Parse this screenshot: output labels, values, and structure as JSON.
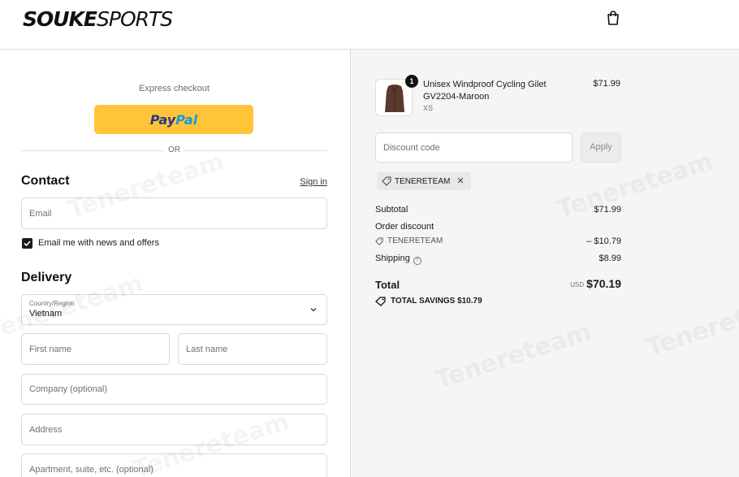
{
  "header": {
    "logo_bold": "SOUKE",
    "logo_rest": "SPORTS",
    "cart_icon": "shopping-bag-icon"
  },
  "checkout": {
    "express_label": "Express checkout",
    "paypal_pay": "Pay",
    "paypal_pal": "Pal",
    "or_label": "OR"
  },
  "contact": {
    "title": "Contact",
    "sign_in": "Sign in",
    "email_placeholder": "Email",
    "newsletter_label": "Email me with news and offers",
    "newsletter_checked": true
  },
  "delivery": {
    "title": "Delivery",
    "country_label": "Country/Region",
    "country_value": "Vietnam",
    "first_name_placeholder": "First name",
    "last_name_placeholder": "Last name",
    "company_placeholder": "Company (optional)",
    "address_placeholder": "Address",
    "apartment_placeholder": "Apartment, suite, etc. (optional)"
  },
  "order": {
    "item": {
      "name": "Unisex Windproof Cycling Gilet GV2204-Maroon",
      "variant": "XS",
      "price": "$71.99",
      "quantity": "1"
    },
    "discount_placeholder": "Discount code",
    "apply_label": "Apply",
    "applied_code": "TENERETEAM",
    "subtotal_label": "Subtotal",
    "subtotal_value": "$71.99",
    "order_discount_label": "Order discount",
    "discount_code_label": "TENERETEAM",
    "discount_value": "– $10.79",
    "shipping_label": "Shipping",
    "shipping_value": "$8.99",
    "total_label": "Total",
    "currency": "USD",
    "total_value": "$70.19",
    "savings_label": "TOTAL SAVINGS",
    "savings_value": "$10.79"
  },
  "colors": {
    "paypal_yellow": "#ffc439",
    "paypal_dark": "#253b80",
    "paypal_light": "#179bd7",
    "summary_bg": "#f5f5f5"
  },
  "watermark": "Tenereteam"
}
